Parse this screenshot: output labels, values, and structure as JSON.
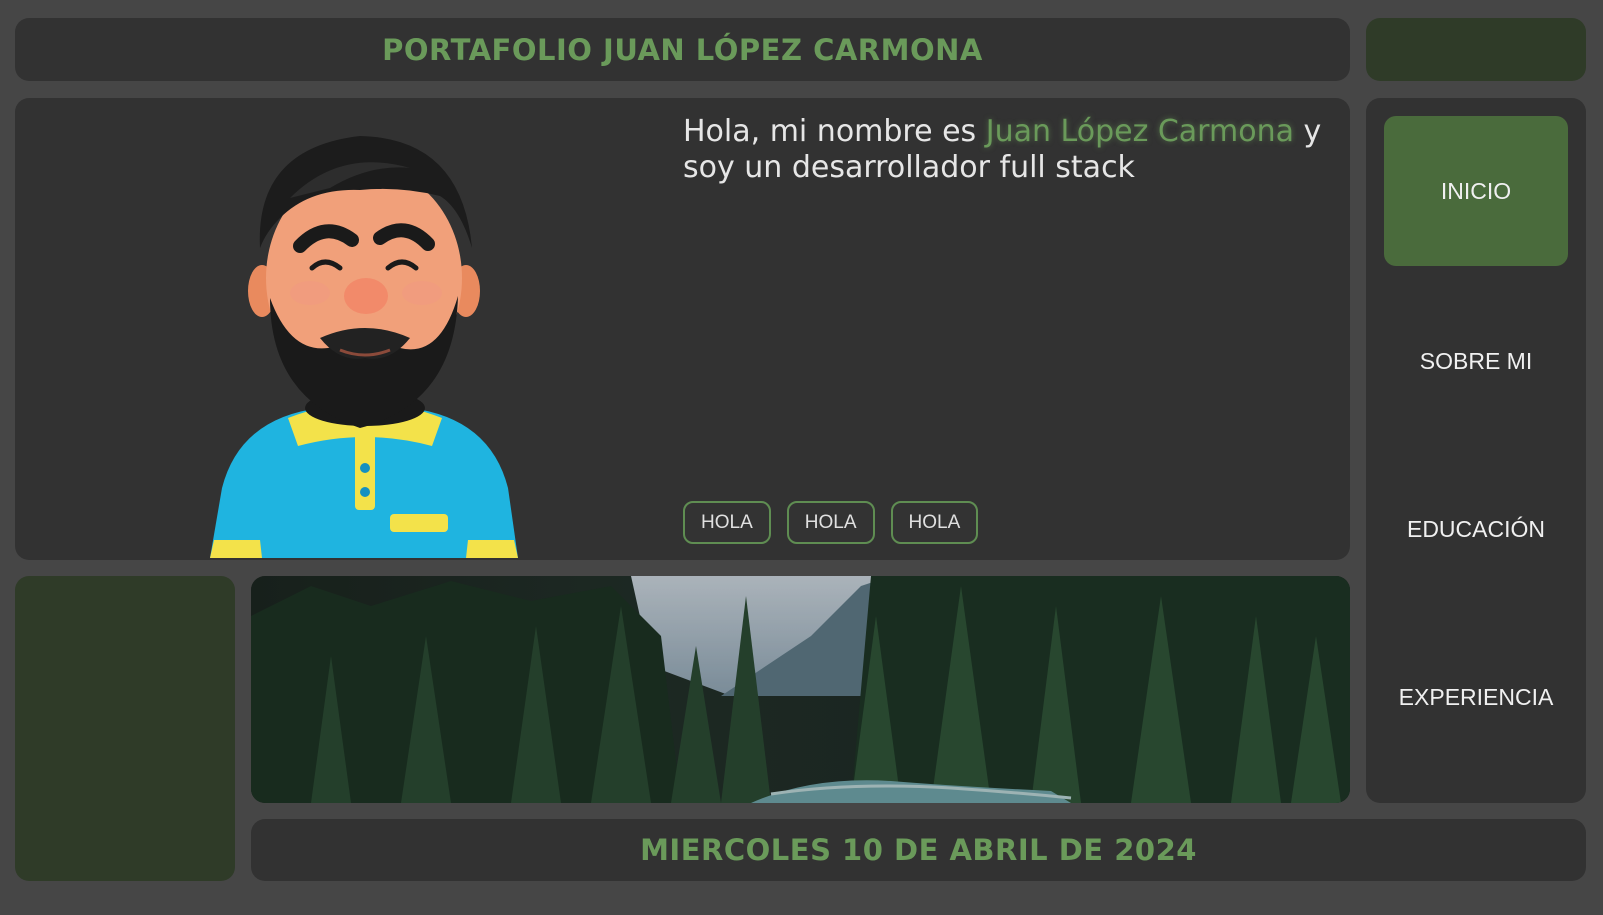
{
  "header": {
    "title": "PORTAFOLIO JUAN LÓPEZ CARMONA"
  },
  "hero": {
    "intro_before": "Hola, mi nombre es ",
    "intro_name": "Juan López Carmona",
    "intro_after": " y soy un desarrollador full stack",
    "tags": [
      "HOLA",
      "HOLA",
      "HOLA"
    ]
  },
  "nav": {
    "items": [
      {
        "label": "INICIO",
        "active": true
      },
      {
        "label": "SOBRE MI",
        "active": false
      },
      {
        "label": "EDUCACIÓN",
        "active": false
      },
      {
        "label": "EXPERIENCIA",
        "active": false
      }
    ]
  },
  "footer": {
    "date": "MIERCOLES 10 DE ABRIL DE 2024"
  },
  "colors": {
    "background": "#464646",
    "panel": "#323232",
    "accent": "#6a9a5a",
    "active_nav": "#4a6b3c",
    "dark_green_panel": "#2f3b28"
  }
}
